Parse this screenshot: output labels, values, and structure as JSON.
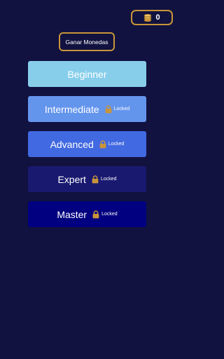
{
  "header": {
    "coins": {
      "icon": "coin-stack-icon",
      "count": "0",
      "border_color": "#c9953a"
    },
    "earn_button_label": "Ganar Monedas"
  },
  "levels": [
    {
      "name": "Beginner",
      "locked": false,
      "color": "#87ceeb"
    },
    {
      "name": "Intermediate",
      "locked": true,
      "lock_label": "Locked",
      "color": "#6495ed"
    },
    {
      "name": "Advanced",
      "locked": true,
      "lock_label": "Locked",
      "color": "#4169e1"
    },
    {
      "name": "Expert",
      "locked": true,
      "lock_label": "Locked",
      "color": "#191970"
    },
    {
      "name": "Master",
      "locked": true,
      "lock_label": "Locked",
      "color": "#000080"
    }
  ],
  "colors": {
    "background": "#11123f",
    "accent": "#c9953a",
    "lock": "#c9953a"
  }
}
